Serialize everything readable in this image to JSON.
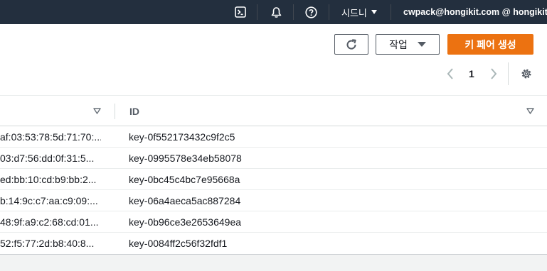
{
  "topbar": {
    "icons": [
      "cloudshell-icon",
      "bell-icon",
      "help-icon"
    ],
    "region_label": "시드니",
    "account_label": "cwpack@hongikit.com @ hongikit"
  },
  "toolbar": {
    "refresh_icon": "refresh-icon",
    "actions_label": "작업",
    "create_label": "키 페어 생성"
  },
  "pagination": {
    "current_page": "1",
    "settings_icon": "gear-icon"
  },
  "table": {
    "columns": [
      "",
      "ID"
    ],
    "rows": [
      {
        "fingerprint": "af:03:53:78:5d:71:70:...",
        "id": "key-0f552173432c9f2c5"
      },
      {
        "fingerprint": "03:d7:56:dd:0f:31:5...",
        "id": "key-0995578e34eb58078"
      },
      {
        "fingerprint": "ed:bb:10:cd:b9:bb:2...",
        "id": "key-0bc45c4bc7e95668a"
      },
      {
        "fingerprint": "b:14:9c:c7:aa:c9:09:...",
        "id": "key-06a4aeca5ac887284"
      },
      {
        "fingerprint": "48:9f:a9:c2:68:cd:01...",
        "id": "key-0b96ce3e2653649ea"
      },
      {
        "fingerprint": "52:f5:77:2d:b8:40:8...",
        "id": "key-0084ff2c56f32fdf1"
      }
    ]
  },
  "colors": {
    "nav_bg": "#232f3e",
    "primary": "#ec7211",
    "page_bg": "#f2f3f3"
  }
}
